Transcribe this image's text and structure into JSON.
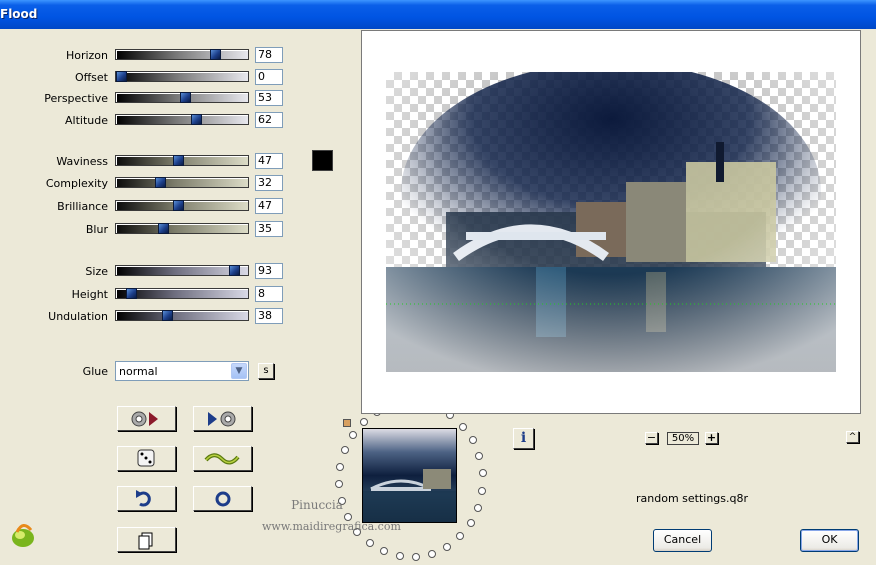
{
  "window": {
    "title": "Flood"
  },
  "sliders": [
    {
      "key": "horizon",
      "label": "Horizon",
      "value": "78",
      "level": 78
    },
    {
      "key": "offset",
      "label": "Offset",
      "value": "0",
      "level": 0
    },
    {
      "key": "perspective",
      "label": "Perspective",
      "value": "53",
      "level": 53
    },
    {
      "key": "altitude",
      "label": "Altitude",
      "value": "62",
      "level": 62
    },
    {
      "key": "waviness",
      "label": "Waviness",
      "value": "47",
      "level": 47
    },
    {
      "key": "complexity",
      "label": "Complexity",
      "value": "32",
      "level": 32
    },
    {
      "key": "brilliance",
      "label": "Brilliance",
      "value": "47",
      "level": 47
    },
    {
      "key": "blur",
      "label": "Blur",
      "value": "35",
      "level": 35
    },
    {
      "key": "size",
      "label": "Size",
      "value": "93",
      "level": 93
    },
    {
      "key": "height",
      "label": "Height",
      "value": "8",
      "level": 8
    },
    {
      "key": "undulation",
      "label": "Undulation",
      "value": "38",
      "level": 38
    }
  ],
  "color_swatch": {
    "color": "#000000"
  },
  "glue": {
    "label": "Glue",
    "value": "normal",
    "s_button": "s"
  },
  "zoom": {
    "value": "50%",
    "minus": "−",
    "plus": "+"
  },
  "settings_file": "random settings.q8r",
  "buttons": {
    "cancel": "Cancel",
    "ok": "OK",
    "info": "i",
    "collapse": "^"
  },
  "watermark": {
    "line1": "Pinuccia",
    "line2": "www.maidiregrafica.com"
  },
  "colors": {
    "titlebar": "#0054e3",
    "dialog_bg": "#ece9d8",
    "slider_thumb": "#1c3f8a"
  }
}
